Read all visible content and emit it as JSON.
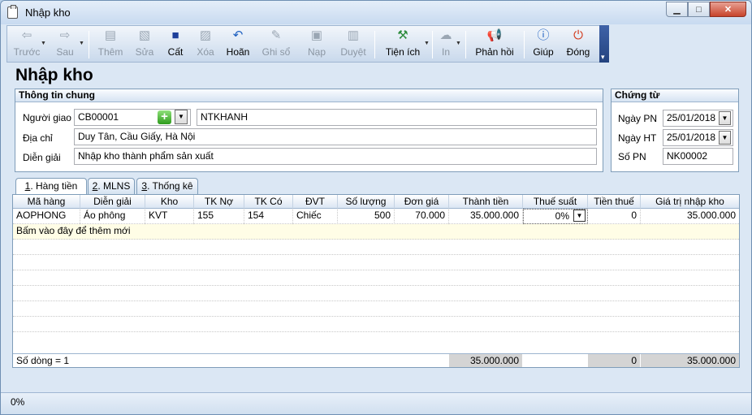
{
  "window": {
    "title": "Nhập kho"
  },
  "toolbar": {
    "items": [
      {
        "label": "Trước",
        "icon": "arrow-left-icon",
        "enabled": false
      },
      {
        "label": "Sau",
        "icon": "arrow-right-icon",
        "enabled": false
      },
      {
        "label": "Thêm",
        "icon": "add-doc-icon",
        "enabled": false
      },
      {
        "label": "Sửa",
        "icon": "edit-doc-icon",
        "enabled": false
      },
      {
        "label": "Cất",
        "icon": "save-icon",
        "enabled": true
      },
      {
        "label": "Xóa",
        "icon": "delete-doc-icon",
        "enabled": false
      },
      {
        "label": "Hoãn",
        "icon": "undo-icon",
        "enabled": true
      },
      {
        "label": "Ghi sổ",
        "icon": "pencil-icon",
        "enabled": false
      },
      {
        "label": "Nạp",
        "icon": "reload-icon",
        "enabled": false
      },
      {
        "label": "Duyệt",
        "icon": "approve-icon",
        "enabled": false
      },
      {
        "label": "Tiện ích",
        "icon": "tools-icon",
        "enabled": true
      },
      {
        "label": "In",
        "icon": "printer-icon",
        "enabled": false
      },
      {
        "label": "Phản hồi",
        "icon": "megaphone-icon",
        "enabled": true
      },
      {
        "label": "Giúp",
        "icon": "help-icon",
        "enabled": true
      },
      {
        "label": "Đóng",
        "icon": "power-icon",
        "enabled": true
      }
    ]
  },
  "page": {
    "title": "Nhập kho"
  },
  "general": {
    "heading": "Thông tin chung",
    "deliverer_label": "Người giao",
    "deliverer_code": "CB00001",
    "deliverer_name": "NTKHANH",
    "address_label": "Địa chỉ",
    "address": "Duy Tân, Cầu Giấy, Hà Nội",
    "description_label": "Diễn giải",
    "description": "Nhập kho thành phẩm sản xuất"
  },
  "voucher": {
    "heading": "Chứng từ",
    "pn_date_label": "Ngày PN",
    "pn_date": "25/01/2018",
    "ht_date_label": "Ngày HT",
    "ht_date": "25/01/2018",
    "pn_no_label": "Số PN",
    "pn_no": "NK00002"
  },
  "tabs": [
    {
      "num": "1",
      "label": ". Hàng tiền"
    },
    {
      "num": "2",
      "label": ". MLNS"
    },
    {
      "num": "3",
      "label": ". Thống kê"
    }
  ],
  "grid": {
    "columns": [
      "Mã hàng",
      "Diễn giải",
      "Kho",
      "TK Nợ",
      "TK Có",
      "ĐVT",
      "Số lượng",
      "Đơn giá",
      "Thành tiền",
      "Thuế suất",
      "Tiền thuế",
      "Giá trị nhập kho"
    ],
    "row": {
      "ma_hang": "AOPHONG",
      "dien_giai": "Áo phông",
      "kho": "KVT",
      "tk_no": "155",
      "tk_co": "154",
      "dvt": "Chiếc",
      "so_luong": "500",
      "don_gia": "70.000",
      "thanh_tien": "35.000.000",
      "thue_suat": "0%",
      "tien_thue": "0",
      "gia_tri": "35.000.000"
    },
    "add_row_text": "Bấm vào đây để thêm mới",
    "footer": {
      "row_count": "Số dòng = 1",
      "thanh_tien": "35.000.000",
      "tien_thue": "0",
      "gia_tri": "35.000.000"
    }
  },
  "status": {
    "text": "0%"
  },
  "colors": {
    "title_bar": "#c8daf0",
    "toolbar_end": "#24437f",
    "add_row": "#fffde6",
    "footer_sum": "#d4d4d4"
  }
}
